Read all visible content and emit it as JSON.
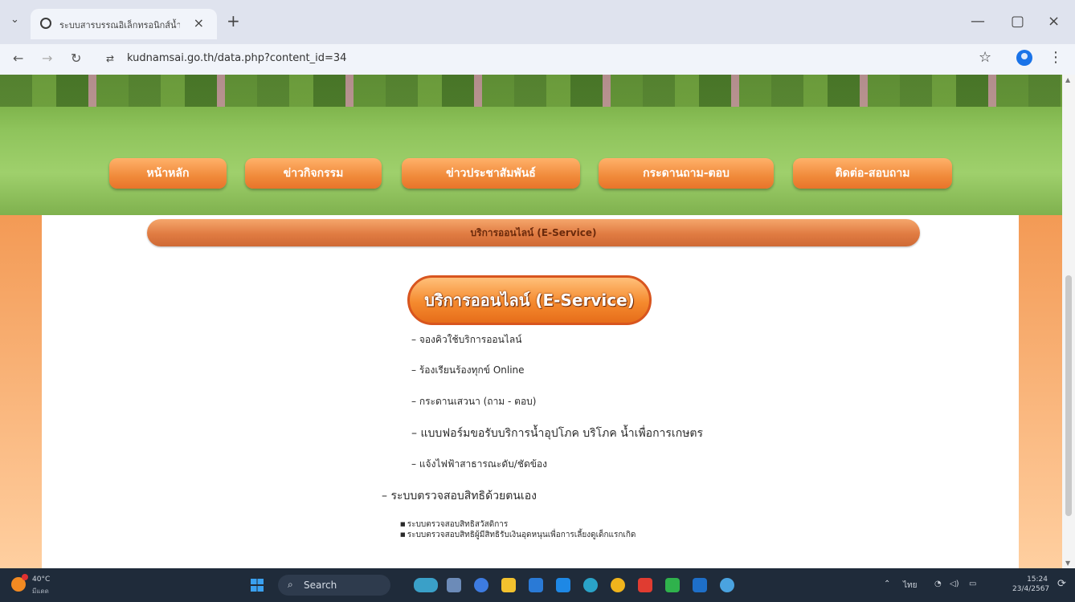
{
  "browser": {
    "tab_title": "ระบบสารบรรณอิเล็กทรอนิกส์น้ำใส",
    "tab_close": "×",
    "new_tab": "+",
    "url": "kudnamsai.go.th/data.php?content_id=34",
    "window": {
      "minimize": "—",
      "maximize": "▢",
      "close": "×"
    }
  },
  "site": {
    "nav": [
      "หน้าหลัก",
      "ข่าวกิจกรรม",
      "ข่าวประชาสัมพันธ์",
      "กระดานถาม-ตอบ",
      "ติดต่อ-สอบถาม"
    ],
    "section_title": "บริการออนไลน์ (E-Service)",
    "pill_title": "บริการออนไลน์ (E-Service)",
    "links": [
      "– จองคิวใช้บริการออนไลน์",
      "– ร้องเรียนร้องทุกข์ Online",
      "– กระดานเสวนา (ถาม - ตอบ)",
      "– แบบฟอร์มขอรับบริการน้ำอุปโภค บริโภค น้ำเพื่อการเกษตร",
      "– แจ้งไฟฟ้าสาธารณะดับ/ชัดข้อง"
    ],
    "subheading": "– ระบบตรวจสอบสิทธิด้วยตนเอง",
    "sublinks": [
      "ระบบตรวจสอบสิทธิสวัสดิการ",
      "ระบบตรวจสอบสิทธิผู้มีสิทธิรับเงินอุดหนุนเพื่อการเลี้ยงดูเด็กแรกเกิด"
    ]
  },
  "taskbar": {
    "temp": "40°C",
    "condition": "มีแดด",
    "search": "Search",
    "lang": "ไทย",
    "time": "15:24",
    "date": "23/4/2567"
  },
  "colors": {
    "orange": "#f08a3a",
    "accent": "#1a73e8"
  }
}
